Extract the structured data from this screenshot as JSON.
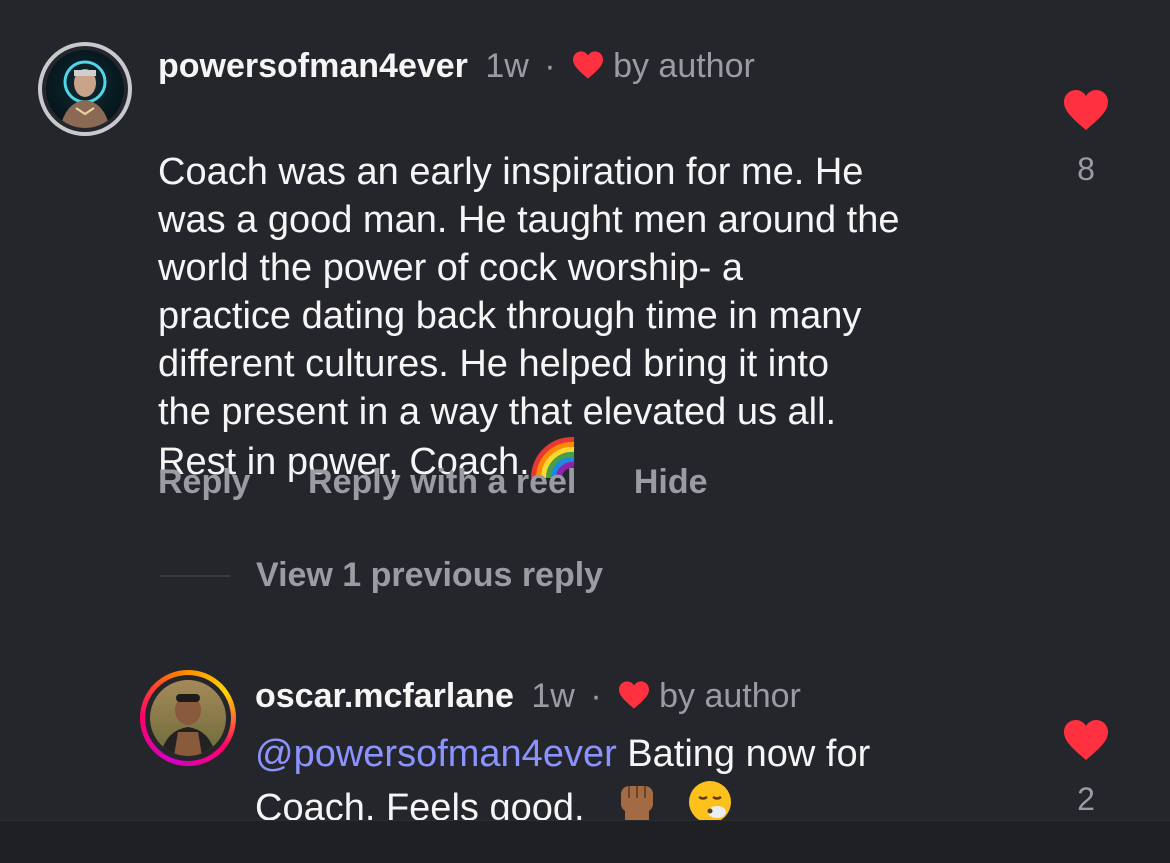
{
  "comments": [
    {
      "username": "powersofman4ever",
      "age": "1w",
      "separator": "·",
      "liked_by": "by author",
      "text": "Coach was an early inspiration for me. He\nwas a good man. He taught men around the\nworld the power of cock worship- a\npractice dating back through time in many\ndifferent cultures. He helped bring it into\nthe present in a way that elevated us all.\nRest in power, Coach.",
      "emoji_trailing": "rainbow-emoji",
      "like_count": "8",
      "actions": {
        "reply": "Reply",
        "reply_reel": "Reply with a reel",
        "hide": "Hide"
      },
      "view_replies": "View 1 previous reply"
    },
    {
      "username": "oscar.mcfarlane",
      "age": "1w",
      "separator": "·",
      "liked_by": "by author",
      "mention": "@powersofman4ever",
      "text_line1": " Bating now for",
      "text_line2": "Coach. Feels good.",
      "emojis": [
        "raised-fist-emoji",
        "face-exhaling-emoji"
      ],
      "like_count": "2"
    }
  ],
  "colors": {
    "background": "#25262b",
    "heart": "#ff3040",
    "muted": "#9a9ca3",
    "mention": "#8a93ff",
    "ring_gradient": [
      "#ffd600",
      "#ff0169",
      "#d300c5"
    ]
  }
}
